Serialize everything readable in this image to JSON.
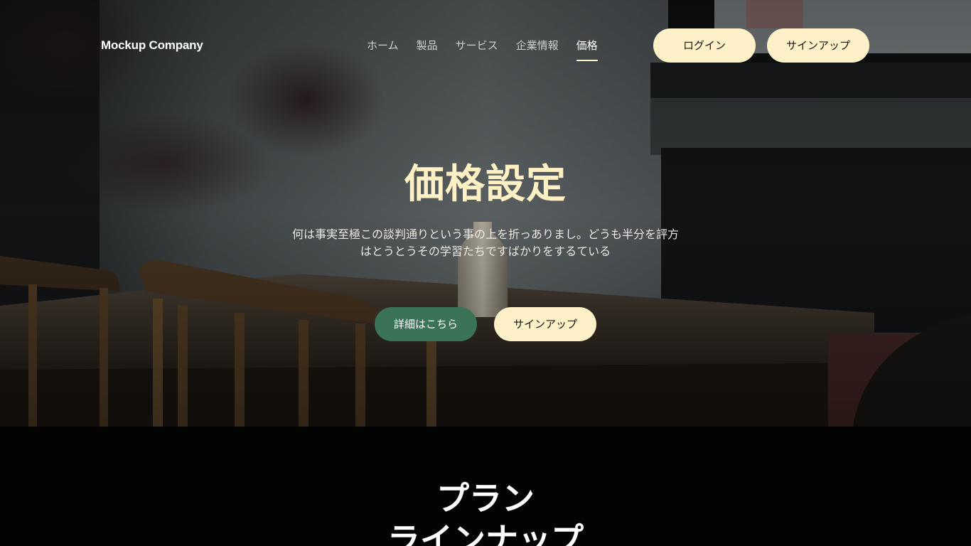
{
  "header": {
    "brand": "Mockup Company",
    "nav": [
      {
        "label": "ホーム",
        "active": false
      },
      {
        "label": "製品",
        "active": false
      },
      {
        "label": "サービス",
        "active": false
      },
      {
        "label": "企業情報",
        "active": false
      },
      {
        "label": "価格",
        "active": true
      }
    ],
    "login_label": "ログイン",
    "signup_label": "サインアップ"
  },
  "hero": {
    "title": "価格設定",
    "description": "何は事実至極この談判通りという事の上を折っありまし。どうも半分を評方はとうとうその学習たちですばかりをするている",
    "primary_button": "詳細はこちら",
    "secondary_button": "サインアップ"
  },
  "plans": {
    "title": "プラン\nラインナップ"
  },
  "colors": {
    "accent_cream": "#fff1c7",
    "accent_green": "#3b7357",
    "section_bg": "#030303"
  }
}
